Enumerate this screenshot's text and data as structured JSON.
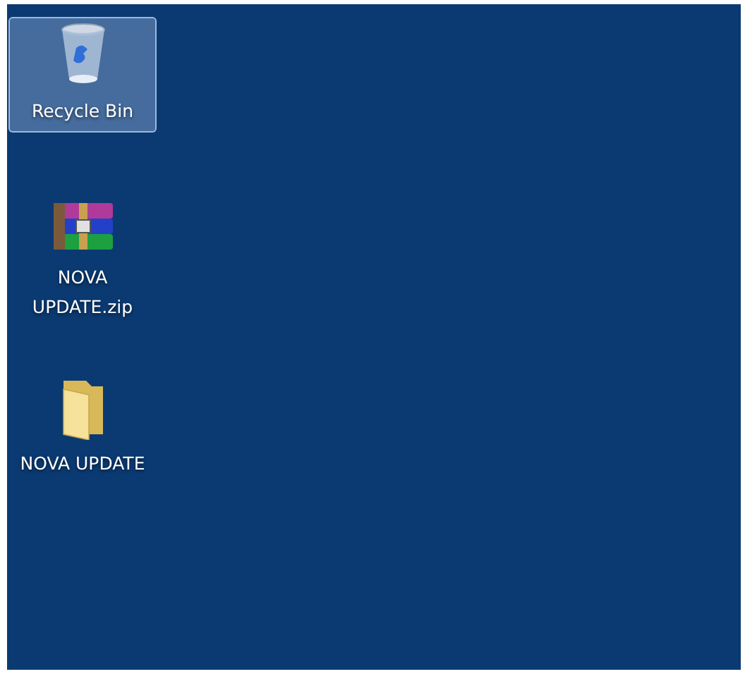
{
  "desktop": {
    "icons": [
      {
        "kind": "recycle-bin",
        "label": "Recycle Bin",
        "selected": true
      },
      {
        "kind": "archive",
        "label": "NOVA UPDATE.zip",
        "selected": false
      },
      {
        "kind": "folder",
        "label": "NOVA UPDATE",
        "selected": false
      }
    ]
  }
}
